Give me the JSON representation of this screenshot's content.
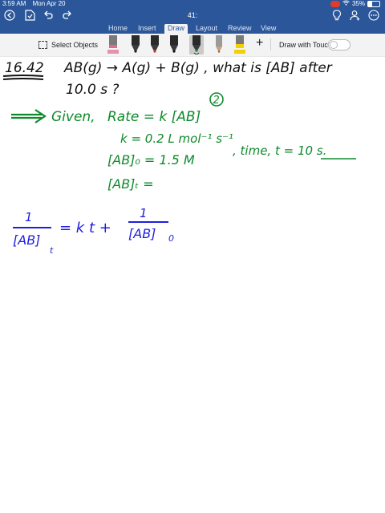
{
  "status_bar": {
    "time": "3:59 AM",
    "date": "Mon Apr 20",
    "battery": "35%",
    "battery_level": 0.35
  },
  "title_bar": {
    "document_title": "41:"
  },
  "tabs": [
    {
      "label": "Home",
      "active": false
    },
    {
      "label": "Insert",
      "active": false
    },
    {
      "label": "Draw",
      "active": true
    },
    {
      "label": "Layout",
      "active": false
    },
    {
      "label": "Review",
      "active": false
    },
    {
      "label": "View",
      "active": false
    }
  ],
  "toolbar": {
    "select_objects_label": "Select Objects",
    "draw_with_touch_label": "Draw with Touch",
    "draw_with_touch_on": false,
    "pens": [
      {
        "name": "pen-pink",
        "color": "#e06a8a"
      },
      {
        "name": "pen-black",
        "color": "#222222"
      },
      {
        "name": "pen-red",
        "color": "#d43a2f"
      },
      {
        "name": "pen-black-2",
        "color": "#222222"
      },
      {
        "name": "pen-green",
        "color": "#0f8a2a"
      },
      {
        "name": "pen-gray",
        "color": "#8c8c8c"
      },
      {
        "name": "pen-yellow",
        "color": "#f5d000"
      }
    ]
  },
  "notes": {
    "colors": {
      "black": "#111111",
      "green": "#0e8a2a",
      "blue": "#1d1ee0"
    },
    "problem_number": "16.42",
    "problem_text_1": "AB(g) → A(g) + B(g) , what is [AB] after",
    "problem_text_2": "10.0 s ?",
    "given_label": "Given,",
    "rate_law": "Rate = k [AB]",
    "rate_exponent": "2",
    "k_value": "k = 0.2  L mol⁻¹ s⁻¹",
    "ab0_value": "[AB]₀ = 1.5 M",
    "time_value": ", time, t = 10 s.",
    "abt_label": "[AB]ₜ =",
    "eq_lhs_num": "1",
    "eq_lhs_den": "[AB]",
    "eq_lhs_sub": "t",
    "eq_equals_kt": "= k t +",
    "eq_rhs_num": "1",
    "eq_rhs_den": "[AB]",
    "eq_rhs_sub": "0"
  }
}
